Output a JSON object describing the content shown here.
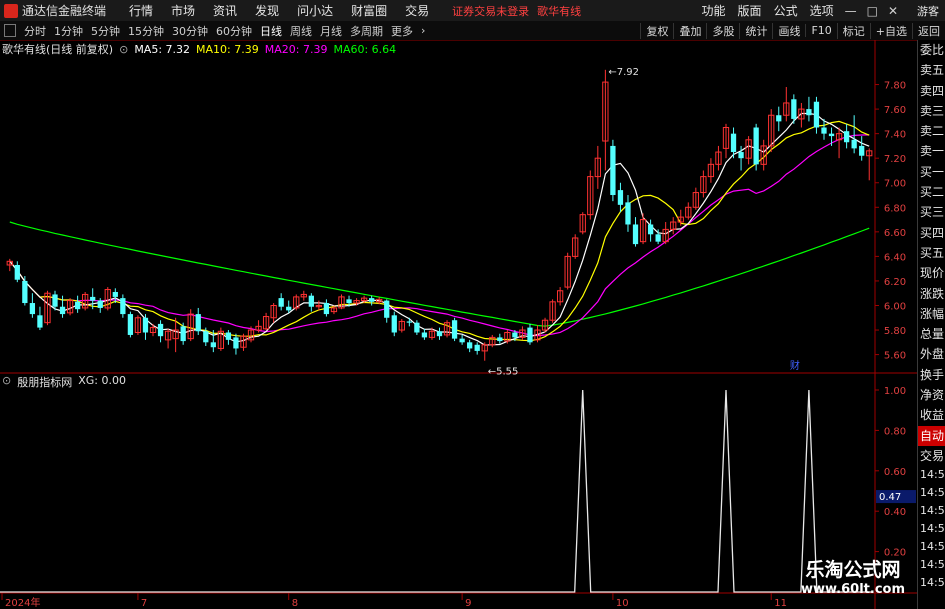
{
  "app": {
    "title": "通达信金融终端",
    "login_status": "证券交易未登录",
    "stock_tag": "歌华有线",
    "guest": "游客"
  },
  "menu": [
    "行情",
    "市场",
    "资讯",
    "发现",
    "问小达",
    "财富圈",
    "交易"
  ],
  "menu_right": [
    "功能",
    "版面",
    "公式",
    "选项"
  ],
  "toolbar": {
    "periods": [
      "分时",
      "1分钟",
      "5分钟",
      "15分钟",
      "30分钟",
      "60分钟",
      "日线",
      "周线",
      "月线",
      "多周期",
      "更多"
    ],
    "active": "日线",
    "right_buttons": [
      "复权",
      "叠加",
      "多股",
      "统计",
      "画线",
      "F10",
      "标记",
      "+自选",
      "返回"
    ]
  },
  "legend": {
    "name": "歌华有线(日线 前复权)",
    "ma5": "MA5: 7.32",
    "ma10": "MA10: 7.39",
    "ma20": "MA20: 7.39",
    "ma60": "MA60: 6.64",
    "colors": {
      "ma5": "#ffffff",
      "ma10": "#ffff00",
      "ma20": "#ff00ff",
      "ma60": "#00ff00"
    }
  },
  "indicator": {
    "name": "殷朋指标网",
    "xg": "XG: 0.00",
    "current": "0.47"
  },
  "price_axis": [
    "7.80",
    "7.60",
    "7.40",
    "7.20",
    "7.00",
    "6.80",
    "6.60",
    "6.40",
    "6.20",
    "6.00",
    "5.80",
    "5.60"
  ],
  "indicator_axis": [
    "1.00",
    "0.80",
    "0.60",
    "0.40",
    "0.20"
  ],
  "annotations": {
    "high": "7.92",
    "low": "5.55",
    "marker_fin": "财"
  },
  "date_axis": [
    "2024年",
    "7",
    "8",
    "9",
    "10",
    "11"
  ],
  "right_panel": [
    "委比",
    "卖五",
    "卖四",
    "卖三",
    "卖二",
    "卖一",
    "买一",
    "买二",
    "买三",
    "买四",
    "买五",
    "现价",
    "涨跌",
    "涨幅",
    "总量",
    "外盘",
    "换手",
    "净资",
    "收益"
  ],
  "right_panel_bottom": [
    "自动",
    "交易"
  ],
  "times": [
    "14:56",
    "14:56",
    "14:56",
    "14:56",
    "14:56",
    "14:56",
    "14:56"
  ],
  "watermark": {
    "line1": "乐淘公式网",
    "line2": "www.60lt.com"
  },
  "chart_data": {
    "type": "candlestick",
    "price_range": [
      5.5,
      7.95
    ],
    "candles": [
      {
        "o": 6.33,
        "c": 6.36,
        "h": 6.38,
        "l": 6.28
      },
      {
        "o": 6.33,
        "c": 6.21,
        "h": 6.36,
        "l": 6.19
      },
      {
        "o": 6.2,
        "c": 6.02,
        "h": 6.24,
        "l": 6.0
      },
      {
        "o": 6.02,
        "c": 5.93,
        "h": 6.1,
        "l": 5.9
      },
      {
        "o": 5.92,
        "c": 5.82,
        "h": 5.99,
        "l": 5.8
      },
      {
        "o": 5.86,
        "c": 6.1,
        "h": 6.12,
        "l": 5.84
      },
      {
        "o": 6.09,
        "c": 5.99,
        "h": 6.12,
        "l": 5.96
      },
      {
        "o": 5.99,
        "c": 5.93,
        "h": 6.08,
        "l": 5.9
      },
      {
        "o": 5.94,
        "c": 6.04,
        "h": 6.06,
        "l": 5.92
      },
      {
        "o": 6.03,
        "c": 5.97,
        "h": 6.08,
        "l": 5.94
      },
      {
        "o": 5.98,
        "c": 6.09,
        "h": 6.11,
        "l": 5.96
      },
      {
        "o": 6.07,
        "c": 6.04,
        "h": 6.14,
        "l": 5.97
      },
      {
        "o": 6.04,
        "c": 5.98,
        "h": 6.06,
        "l": 5.94
      },
      {
        "o": 5.98,
        "c": 6.13,
        "h": 6.15,
        "l": 5.96
      },
      {
        "o": 6.11,
        "c": 6.07,
        "h": 6.14,
        "l": 6.02
      },
      {
        "o": 6.06,
        "c": 5.93,
        "h": 6.09,
        "l": 5.9
      },
      {
        "o": 5.93,
        "c": 5.76,
        "h": 5.95,
        "l": 5.74
      },
      {
        "o": 5.78,
        "c": 5.9,
        "h": 5.92,
        "l": 5.76
      },
      {
        "o": 5.9,
        "c": 5.78,
        "h": 5.93,
        "l": 5.72
      },
      {
        "o": 5.78,
        "c": 5.82,
        "h": 5.85,
        "l": 5.75
      },
      {
        "o": 5.85,
        "c": 5.75,
        "h": 5.88,
        "l": 5.7
      },
      {
        "o": 5.72,
        "c": 5.79,
        "h": 5.81,
        "l": 5.65
      },
      {
        "o": 5.73,
        "c": 5.8,
        "h": 5.9,
        "l": 5.62
      },
      {
        "o": 5.83,
        "c": 5.71,
        "h": 5.86,
        "l": 5.68
      },
      {
        "o": 5.73,
        "c": 5.93,
        "h": 5.97,
        "l": 5.71
      },
      {
        "o": 5.93,
        "c": 5.79,
        "h": 5.98,
        "l": 5.76
      },
      {
        "o": 5.79,
        "c": 5.7,
        "h": 5.82,
        "l": 5.67
      },
      {
        "o": 5.7,
        "c": 5.66,
        "h": 5.8,
        "l": 5.62
      },
      {
        "o": 5.65,
        "c": 5.79,
        "h": 5.82,
        "l": 5.63
      },
      {
        "o": 5.78,
        "c": 5.72,
        "h": 5.8,
        "l": 5.68
      },
      {
        "o": 5.74,
        "c": 5.65,
        "h": 5.77,
        "l": 5.6
      },
      {
        "o": 5.66,
        "c": 5.75,
        "h": 5.77,
        "l": 5.63
      },
      {
        "o": 5.72,
        "c": 5.8,
        "h": 5.83,
        "l": 5.7
      },
      {
        "o": 5.8,
        "c": 5.83,
        "h": 5.88,
        "l": 5.78
      },
      {
        "o": 5.81,
        "c": 5.91,
        "h": 5.94,
        "l": 5.8
      },
      {
        "o": 5.9,
        "c": 6.0,
        "h": 6.02,
        "l": 5.86
      },
      {
        "o": 6.06,
        "c": 5.99,
        "h": 6.1,
        "l": 5.96
      },
      {
        "o": 5.99,
        "c": 5.96,
        "h": 6.04,
        "l": 5.94
      },
      {
        "o": 5.98,
        "c": 6.07,
        "h": 6.09,
        "l": 5.96
      },
      {
        "o": 6.07,
        "c": 6.09,
        "h": 6.12,
        "l": 6.04
      },
      {
        "o": 6.08,
        "c": 5.99,
        "h": 6.1,
        "l": 5.95
      },
      {
        "o": 5.99,
        "c": 6.0,
        "h": 6.04,
        "l": 5.96
      },
      {
        "o": 6.02,
        "c": 5.93,
        "h": 6.05,
        "l": 5.91
      },
      {
        "o": 5.95,
        "c": 5.98,
        "h": 6.0,
        "l": 5.93
      },
      {
        "o": 5.98,
        "c": 6.07,
        "h": 6.09,
        "l": 5.97
      },
      {
        "o": 6.05,
        "c": 6.02,
        "h": 6.08,
        "l": 5.99
      },
      {
        "o": 6.02,
        "c": 6.04,
        "h": 6.06,
        "l": 6.0
      },
      {
        "o": 6.04,
        "c": 6.06,
        "h": 6.08,
        "l": 6.02
      },
      {
        "o": 6.06,
        "c": 6.03,
        "h": 6.08,
        "l": 6.0
      },
      {
        "o": 6.03,
        "c": 6.05,
        "h": 6.07,
        "l": 6.01
      },
      {
        "o": 6.04,
        "c": 5.9,
        "h": 6.05,
        "l": 5.86
      },
      {
        "o": 5.92,
        "c": 5.78,
        "h": 5.95,
        "l": 5.75
      },
      {
        "o": 5.8,
        "c": 5.87,
        "h": 5.89,
        "l": 5.78
      },
      {
        "o": 5.87,
        "c": 5.86,
        "h": 5.9,
        "l": 5.83
      },
      {
        "o": 5.86,
        "c": 5.78,
        "h": 5.88,
        "l": 5.76
      },
      {
        "o": 5.78,
        "c": 5.74,
        "h": 5.81,
        "l": 5.72
      },
      {
        "o": 5.74,
        "c": 5.79,
        "h": 5.82,
        "l": 5.72
      },
      {
        "o": 5.79,
        "c": 5.75,
        "h": 5.82,
        "l": 5.72
      },
      {
        "o": 5.76,
        "c": 5.86,
        "h": 5.88,
        "l": 5.74
      },
      {
        "o": 5.88,
        "c": 5.73,
        "h": 5.9,
        "l": 5.71
      },
      {
        "o": 5.73,
        "c": 5.7,
        "h": 5.76,
        "l": 5.68
      },
      {
        "o": 5.7,
        "c": 5.65,
        "h": 5.72,
        "l": 5.62
      },
      {
        "o": 5.68,
        "c": 5.63,
        "h": 5.7,
        "l": 5.6
      },
      {
        "o": 5.63,
        "c": 5.68,
        "h": 5.7,
        "l": 5.55
      },
      {
        "o": 5.68,
        "c": 5.74,
        "h": 5.76,
        "l": 5.66
      },
      {
        "o": 5.74,
        "c": 5.71,
        "h": 5.77,
        "l": 5.69
      },
      {
        "o": 5.71,
        "c": 5.78,
        "h": 5.8,
        "l": 5.69
      },
      {
        "o": 5.78,
        "c": 5.74,
        "h": 5.8,
        "l": 5.71
      },
      {
        "o": 5.74,
        "c": 5.8,
        "h": 5.83,
        "l": 5.72
      },
      {
        "o": 5.82,
        "c": 5.7,
        "h": 5.85,
        "l": 5.68
      },
      {
        "o": 5.72,
        "c": 5.8,
        "h": 5.84,
        "l": 5.7
      },
      {
        "o": 5.8,
        "c": 5.88,
        "h": 5.9,
        "l": 5.78
      },
      {
        "o": 5.88,
        "c": 6.03,
        "h": 6.05,
        "l": 5.86
      },
      {
        "o": 6.03,
        "c": 6.12,
        "h": 6.15,
        "l": 6.0
      },
      {
        "o": 6.15,
        "c": 6.4,
        "h": 6.43,
        "l": 6.13
      },
      {
        "o": 6.4,
        "c": 6.55,
        "h": 6.58,
        "l": 6.38
      },
      {
        "o": 6.6,
        "c": 6.74,
        "h": 6.76,
        "l": 6.58
      },
      {
        "o": 6.74,
        "c": 7.05,
        "h": 7.1,
        "l": 6.7
      },
      {
        "o": 7.05,
        "c": 7.2,
        "h": 7.3,
        "l": 6.95
      },
      {
        "o": 7.34,
        "c": 7.82,
        "h": 7.92,
        "l": 7.1
      },
      {
        "o": 7.3,
        "c": 6.9,
        "h": 7.35,
        "l": 6.85
      },
      {
        "o": 6.94,
        "c": 6.82,
        "h": 7.0,
        "l": 6.76
      },
      {
        "o": 6.84,
        "c": 6.66,
        "h": 6.9,
        "l": 6.6
      },
      {
        "o": 6.66,
        "c": 6.5,
        "h": 6.72,
        "l": 6.48
      },
      {
        "o": 6.52,
        "c": 6.7,
        "h": 6.75,
        "l": 6.5
      },
      {
        "o": 6.66,
        "c": 6.58,
        "h": 6.7,
        "l": 6.52
      },
      {
        "o": 6.58,
        "c": 6.52,
        "h": 6.62,
        "l": 6.5
      },
      {
        "o": 6.52,
        "c": 6.62,
        "h": 6.68,
        "l": 6.5
      },
      {
        "o": 6.62,
        "c": 6.68,
        "h": 6.72,
        "l": 6.58
      },
      {
        "o": 6.68,
        "c": 6.72,
        "h": 6.78,
        "l": 6.65
      },
      {
        "o": 6.72,
        "c": 6.8,
        "h": 6.84,
        "l": 6.7
      },
      {
        "o": 6.8,
        "c": 6.92,
        "h": 6.96,
        "l": 6.78
      },
      {
        "o": 6.92,
        "c": 7.05,
        "h": 7.1,
        "l": 6.88
      },
      {
        "o": 7.05,
        "c": 7.15,
        "h": 7.2,
        "l": 7.0
      },
      {
        "o": 7.15,
        "c": 7.25,
        "h": 7.3,
        "l": 7.1
      },
      {
        "o": 7.28,
        "c": 7.45,
        "h": 7.48,
        "l": 7.2
      },
      {
        "o": 7.4,
        "c": 7.25,
        "h": 7.45,
        "l": 7.2
      },
      {
        "o": 7.25,
        "c": 7.2,
        "h": 7.3,
        "l": 7.1
      },
      {
        "o": 7.2,
        "c": 7.35,
        "h": 7.38,
        "l": 7.15
      },
      {
        "o": 7.45,
        "c": 7.15,
        "h": 7.48,
        "l": 7.1
      },
      {
        "o": 7.15,
        "c": 7.3,
        "h": 7.35,
        "l": 7.1
      },
      {
        "o": 7.3,
        "c": 7.55,
        "h": 7.6,
        "l": 7.25
      },
      {
        "o": 7.55,
        "c": 7.5,
        "h": 7.62,
        "l": 7.42
      },
      {
        "o": 7.55,
        "c": 7.65,
        "h": 7.78,
        "l": 7.5
      },
      {
        "o": 7.68,
        "c": 7.52,
        "h": 7.72,
        "l": 7.48
      },
      {
        "o": 7.52,
        "c": 7.6,
        "h": 7.65,
        "l": 7.45
      },
      {
        "o": 7.6,
        "c": 7.55,
        "h": 7.7,
        "l": 7.5
      },
      {
        "o": 7.66,
        "c": 7.45,
        "h": 7.7,
        "l": 7.4
      },
      {
        "o": 7.45,
        "c": 7.4,
        "h": 7.52,
        "l": 7.35
      },
      {
        "o": 7.4,
        "c": 7.38,
        "h": 7.45,
        "l": 7.3
      },
      {
        "o": 7.35,
        "c": 7.4,
        "h": 7.45,
        "l": 7.2
      },
      {
        "o": 7.42,
        "c": 7.33,
        "h": 7.48,
        "l": 7.28
      },
      {
        "o": 7.35,
        "c": 7.28,
        "h": 7.55,
        "l": 7.24
      },
      {
        "o": 7.3,
        "c": 7.22,
        "h": 7.38,
        "l": 7.18
      },
      {
        "o": 7.22,
        "c": 7.26,
        "h": 7.28,
        "l": 7.02
      }
    ],
    "indicator": {
      "name": "XG",
      "range": [
        0,
        1
      ],
      "baseline": 0,
      "spikes_at_candle_index": [
        76,
        95,
        106
      ]
    }
  }
}
